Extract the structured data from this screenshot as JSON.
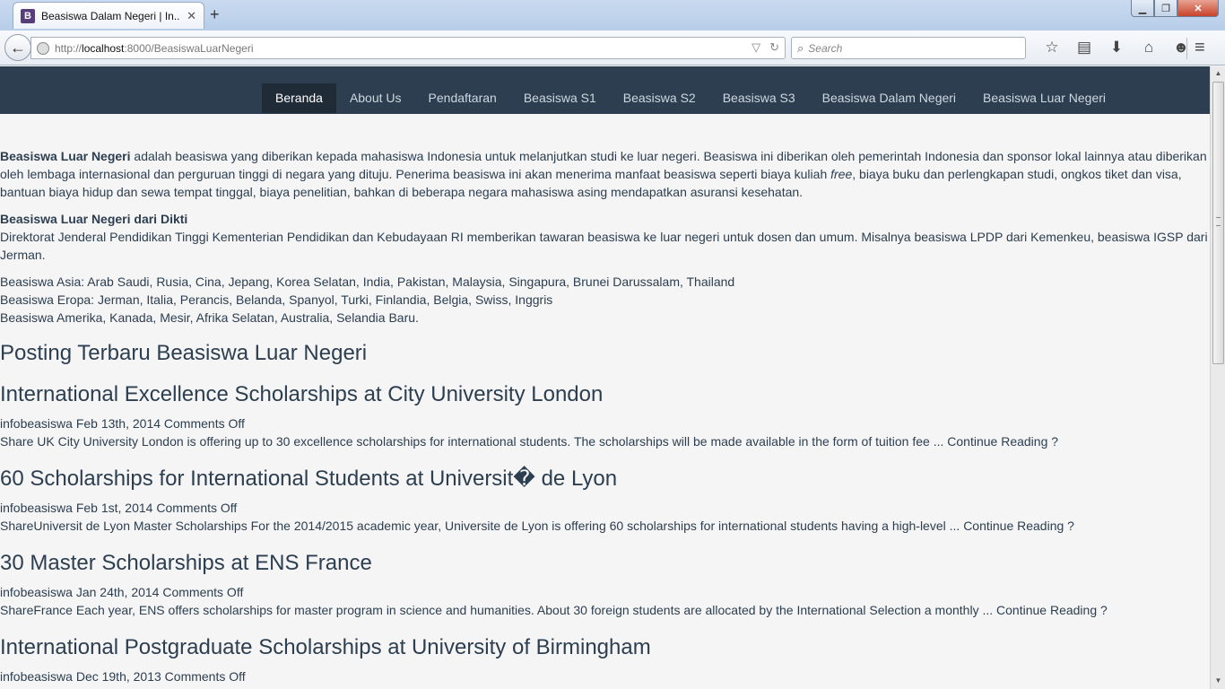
{
  "browser": {
    "tab_title": "Beasiswa Dalam Negeri | In...",
    "tab_favicon": "B",
    "url_prefix": "http://",
    "url_host": "localhost",
    "url_rest": ":8000/BeasiswaLuarNegeri",
    "search_placeholder": "Search",
    "icons": [
      "back-arrow-icon",
      "globe-icon",
      "bookmark-star-icon",
      "reading-list-icon",
      "download-icon",
      "home-icon",
      "smiley-icon",
      "menu-icon"
    ]
  },
  "nav": {
    "items": [
      "Beranda",
      "About Us",
      "Pendaftaran",
      "Beasiswa S1",
      "Beasiswa S2",
      "Beasiswa S3",
      "Beasiswa Dalam Negeri",
      "Beasiswa Luar Negeri"
    ],
    "active": "Beranda"
  },
  "intro": {
    "bold": "Beasiswa Luar Negeri",
    "text1": " adalah beasiswa yang diberikan kepada mahasiswa Indonesia untuk melanjutkan studi ke luar negeri. Beasiswa ini diberikan oleh pemerintah Indonesia dan sponsor lokal lainnya atau diberikan oleh lembaga internasional dan perguruan tinggi di negara yang dituju. Penerima beasiswa ini akan menerima manfaat beasiswa seperti biaya kuliah ",
    "italic": "free",
    "text2": ", biaya buku dan perlengkapan studi, ongkos tiket dan visa, bantuan biaya hidup dan sewa tempat tinggal, biaya penelitian, bahkan di beberapa negara mahasiswa asing mendapatkan asuransi kesehatan."
  },
  "dikti": {
    "heading": "Beasiswa Luar Negeri dari Dikti",
    "text": "Direktorat Jenderal Pendidikan Tinggi Kementerian Pendidikan dan Kebudayaan RI memberikan tawaran beasiswa ke luar negeri untuk dosen dan umum. Misalnya beasiswa LPDP dari Kemenkeu, beasiswa IGSP dari Jerman."
  },
  "regions": {
    "asia": "Beasiswa Asia: Arab Saudi, Rusia, Cina, Jepang, Korea Selatan, India, Pakistan, Malaysia, Singapura, Brunei Darussalam, Thailand",
    "eropa": "Beasiswa Eropa: Jerman, Italia, Perancis, Belanda, Spanyol, Turki, Finlandia, Belgia, Swiss, Inggris",
    "amerika": "Beasiswa Amerika, Kanada, Mesir, Afrika Selatan, Australia, Selandia Baru."
  },
  "latest_heading": "Posting Terbaru Beasiswa Luar Negeri",
  "posts": [
    {
      "title": "International Excellence Scholarships at City University London",
      "meta": "infobeasiswa Feb 13th, 2014 Comments Off",
      "excerpt": "Share UK City University London is offering up to 30 excellence scholarships for international students. The scholarships will be made available in the form of tuition fee ... ",
      "more": "Continue Reading ?"
    },
    {
      "title": "60 Scholarships for International Students at Universit� de Lyon",
      "meta": "infobeasiswa Feb 1st, 2014 Comments Off",
      "excerpt": "ShareUniversit de Lyon Master Scholarships For the 2014/2015 academic year, Universite de Lyon is offering 60 scholarships for international students having a high-level ... ",
      "more": "Continue Reading ?"
    },
    {
      "title": "30 Master Scholarships at ENS France",
      "meta": "infobeasiswa Jan 24th, 2014 Comments Off",
      "excerpt": "ShareFrance Each year, ENS offers scholarships for master program in science and humanities. About 30 foreign students are allocated by the International Selection a monthly ... ",
      "more": "Continue Reading ?"
    },
    {
      "title": "International Postgraduate Scholarships at University of Birmingham",
      "meta": "infobeasiswa Dec 19th, 2013 Comments Off",
      "excerpt": "",
      "more": ""
    }
  ]
}
